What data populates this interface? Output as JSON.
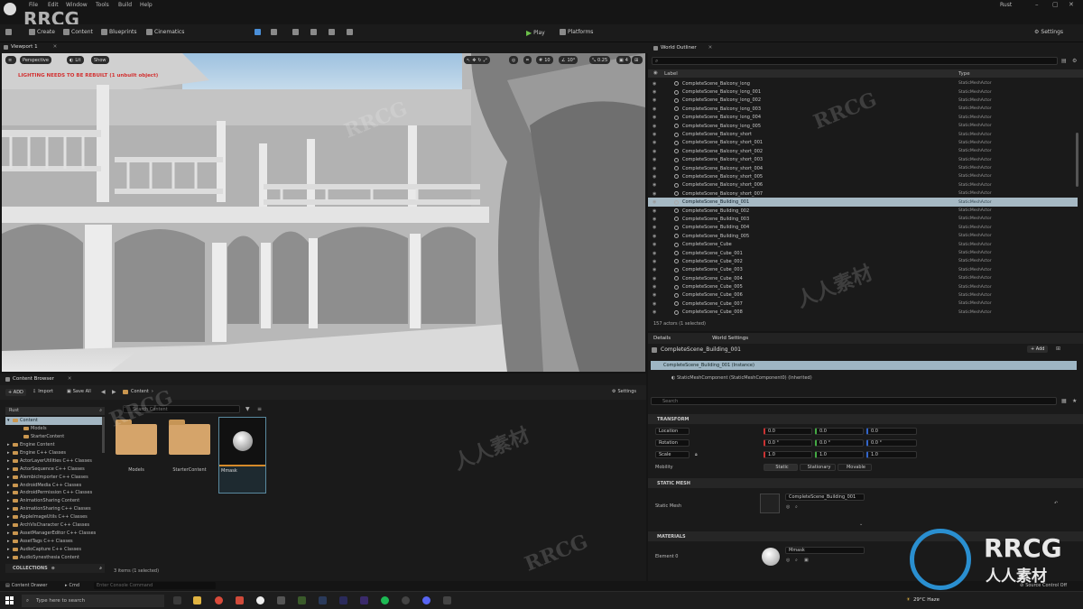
{
  "menu": {
    "items": [
      "File",
      "Edit",
      "Window",
      "Tools",
      "Build",
      "Help"
    ],
    "project": "Rust",
    "watermark_logo": "RRCG"
  },
  "toolbar": {
    "save": "Save",
    "mode": "Create",
    "content": "Content",
    "blueprints": "Blueprints",
    "cinematics": "Cinematics",
    "play": "Play",
    "platforms": "Platforms",
    "settings": "Settings"
  },
  "viewport": {
    "tab": "Viewport 1",
    "perspective": "Perspective",
    "lit": "Lit",
    "show": "Show",
    "warning": "LIGHTING NEEDS TO BE REBUILT (1 unbuilt object)",
    "grid": "10",
    "angle": "10°",
    "scale": "0.25",
    "speed": "4"
  },
  "outliner": {
    "tab": "World Outliner",
    "col_label": "Label",
    "col_type": "Type",
    "items": [
      {
        "name": "CompleteScene_Balcony_long",
        "type": "StaticMeshActor"
      },
      {
        "name": "CompleteScene_Balcony_long_001",
        "type": "StaticMeshActor"
      },
      {
        "name": "CompleteScene_Balcony_long_002",
        "type": "StaticMeshActor"
      },
      {
        "name": "CompleteScene_Balcony_long_003",
        "type": "StaticMeshActor"
      },
      {
        "name": "CompleteScene_Balcony_long_004",
        "type": "StaticMeshActor"
      },
      {
        "name": "CompleteScene_Balcony_long_005",
        "type": "StaticMeshActor"
      },
      {
        "name": "CompleteScene_Balcony_short",
        "type": "StaticMeshActor"
      },
      {
        "name": "CompleteScene_Balcony_short_001",
        "type": "StaticMeshActor"
      },
      {
        "name": "CompleteScene_Balcony_short_002",
        "type": "StaticMeshActor"
      },
      {
        "name": "CompleteScene_Balcony_short_003",
        "type": "StaticMeshActor"
      },
      {
        "name": "CompleteScene_Balcony_short_004",
        "type": "StaticMeshActor"
      },
      {
        "name": "CompleteScene_Balcony_short_005",
        "type": "StaticMeshActor"
      },
      {
        "name": "CompleteScene_Balcony_short_006",
        "type": "StaticMeshActor"
      },
      {
        "name": "CompleteScene_Balcony_short_007",
        "type": "StaticMeshActor"
      },
      {
        "name": "CompleteScene_Building_001",
        "type": "StaticMeshActor",
        "selected": true
      },
      {
        "name": "CompleteScene_Building_002",
        "type": "StaticMeshActor"
      },
      {
        "name": "CompleteScene_Building_003",
        "type": "StaticMeshActor"
      },
      {
        "name": "CompleteScene_Building_004",
        "type": "StaticMeshActor"
      },
      {
        "name": "CompleteScene_Building_005",
        "type": "StaticMeshActor"
      },
      {
        "name": "CompleteScene_Cube",
        "type": "StaticMeshActor"
      },
      {
        "name": "CompleteScene_Cube_001",
        "type": "StaticMeshActor"
      },
      {
        "name": "CompleteScene_Cube_002",
        "type": "StaticMeshActor"
      },
      {
        "name": "CompleteScene_Cube_003",
        "type": "StaticMeshActor"
      },
      {
        "name": "CompleteScene_Cube_004",
        "type": "StaticMeshActor"
      },
      {
        "name": "CompleteScene_Cube_005",
        "type": "StaticMeshActor"
      },
      {
        "name": "CompleteScene_Cube_006",
        "type": "StaticMeshActor"
      },
      {
        "name": "CompleteScene_Cube_007",
        "type": "StaticMeshActor"
      },
      {
        "name": "CompleteScene_Cube_008",
        "type": "StaticMeshActor"
      }
    ],
    "status": "157 actors (1 selected)"
  },
  "details": {
    "tab": "Details",
    "tab2": "World Settings",
    "actor": "CompleteScene_Building_001",
    "add": "+ Add",
    "instance": "CompleteScene_Building_001 (Instance)",
    "component": "StaticMeshComponent (StaticMeshComponent0) (Inherited)",
    "search_placeholder": "Search",
    "transform": "TRANSFORM",
    "location": "Location",
    "rotation": "Rotation",
    "scale": "Scale",
    "mobility": "Mobility",
    "loc": [
      "0.0",
      "0.0",
      "0.0"
    ],
    "rot": [
      "0.0 °",
      "0.0 °",
      "0.0 °"
    ],
    "scl": [
      "1.0",
      "1.0",
      "1.0"
    ],
    "mob": [
      "Static",
      "Stationary",
      "Movable"
    ],
    "static_mesh_section": "STATIC MESH",
    "static_mesh_label": "Static Mesh",
    "static_mesh_value": "CompleteScene_Building_001",
    "materials_section": "MATERIALS",
    "element": "Element 0",
    "material_value": "Mmask"
  },
  "content": {
    "tab": "Content Browser",
    "add": "+ ADD",
    "import": "Import",
    "save_all": "Save All",
    "path": "Content",
    "settings": "Settings",
    "search_placeholder": "Search Content",
    "tree_header": "Rust",
    "tree": [
      "Content",
      "Models",
      "StarterContent",
      "Engine Content",
      "Engine C++ Classes",
      "ActorLayerUtilities C++ Classes",
      "ActorSequence C++ Classes",
      "AlembicImporter C++ Classes",
      "AndroidMedia C++ Classes",
      "AndroidPermission C++ Classes",
      "AnimationSharing Content",
      "AnimationSharing C++ Classes",
      "AppleImageUtils C++ Classes",
      "ArchVisCharacter C++ Classes",
      "AssetManagerEditor C++ Classes",
      "AssetTags C++ Classes",
      "AudioCapture C++ Classes",
      "AudioSynesthesia Content"
    ],
    "assets": [
      "Models",
      "StarterContent",
      "Mmask"
    ],
    "collections": "COLLECTIONS",
    "status": "3 items (1 selected)"
  },
  "statusbar": {
    "drawer": "Content Drawer",
    "cmd": "Cmd",
    "cmd_placeholder": "Enter Console Command",
    "source": "Source Control Off"
  },
  "taskbar": {
    "search": "Type here to search",
    "weather": "29°C Haze"
  },
  "watermark": {
    "brand": "RRCG",
    "cn": "人人素材"
  }
}
